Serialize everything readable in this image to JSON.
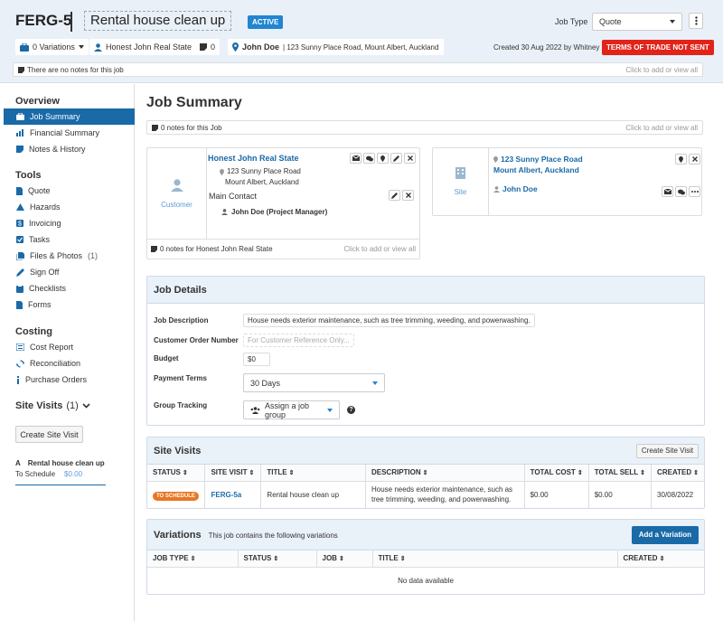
{
  "header": {
    "job_number": "FERG-5",
    "job_title": "Rental house clean up",
    "status_badge": "ACTIVE",
    "job_type_label": "Job Type",
    "job_type_value": "Quote",
    "variations": "0 Variations",
    "client": "Honest John Real State",
    "notes_count": "0",
    "contact_name": "John Doe",
    "contact_address": "| 123 Sunny Place Road, Mount Albert, Auckland",
    "created": "Created 30 Aug 2022 by Whitney",
    "terms_badge": "TERMS OF TRADE NOT SENT",
    "notes_text": "There are  no notes for this job",
    "notes_action": "Click to add or view all"
  },
  "sidebar": {
    "overview_title": "Overview",
    "overview_items": [
      "Job Summary",
      "Financial Summary",
      "Notes & History"
    ],
    "tools_title": "Tools",
    "tools_items": [
      "Quote",
      "Hazards",
      "Invoicing",
      "Tasks",
      "Files & Photos",
      "Sign Off",
      "Checklists",
      "Forms"
    ],
    "files_count": "(1)",
    "costing_title": "Costing",
    "costing_items": [
      "Cost Report",
      "Reconciliation",
      "Purchase Orders"
    ],
    "site_visits_title": "Site Visits",
    "site_visits_count": "(1)",
    "create_site_visit": "Create Site Visit",
    "visit_letter": "A",
    "visit_title": "Rental house clean up",
    "visit_status": "To Schedule",
    "visit_amount": "$0.00"
  },
  "main": {
    "page_title": "Job Summary",
    "notes_text": "0 notes for this Job",
    "notes_action": "Click to add or view all",
    "customer": {
      "label": "Customer",
      "name": "Honest John Real State",
      "address_line1": "123 Sunny Place Road",
      "address_line2": "Mount Albert, Auckland",
      "main_contact_label": "Main Contact",
      "main_contact": "John Doe (Project Manager)",
      "notes_text": "0 notes for Honest John Real State",
      "notes_action": "Click to add or view all"
    },
    "site": {
      "label": "Site",
      "address_line1": "123 Sunny Place Road",
      "address_line2": "Mount Albert, Auckland",
      "contact": "John Doe"
    },
    "job_details": {
      "title": "Job Details",
      "desc_label": "Job Description",
      "desc_value": "House needs exterior maintenance, such as tree trimming, weeding, and powerwashing.",
      "order_label": "Customer Order Number",
      "order_placeholder": "For Customer Reference Only...",
      "budget_label": "Budget",
      "budget_value": "$0",
      "terms_label": "Payment Terms",
      "terms_value": "30 Days",
      "group_label": "Group Tracking",
      "group_value": "Assign a job group"
    },
    "site_visits": {
      "title": "Site Visits",
      "create_button": "Create Site Visit",
      "columns": [
        "STATUS",
        "SITE VISIT",
        "TITLE",
        "DESCRIPTION",
        "TOTAL COST",
        "TOTAL SELL",
        "CREATED"
      ],
      "row": {
        "status": "TO SCHEDULE",
        "site_visit": "FERG-5a",
        "title": "Rental house clean up",
        "description": "House needs exterior maintenance, such as tree trimming, weeding, and powerwashing.",
        "total_cost": "$0.00",
        "total_sell": "$0.00",
        "created": "30/08/2022"
      }
    },
    "variations": {
      "title": "Variations",
      "subtitle": "This job contains the following variations",
      "add_button": "Add a Variation",
      "columns": [
        "JOB TYPE",
        "STATUS",
        "JOB",
        "TITLE",
        "CREATED"
      ],
      "empty": "No data available"
    }
  },
  "colors": {
    "accent": "#1a6aa8",
    "active_badge": "#2185d0",
    "danger": "#e2231a",
    "status_orange": "#e87722",
    "header_bg": "#e9f0f8"
  }
}
